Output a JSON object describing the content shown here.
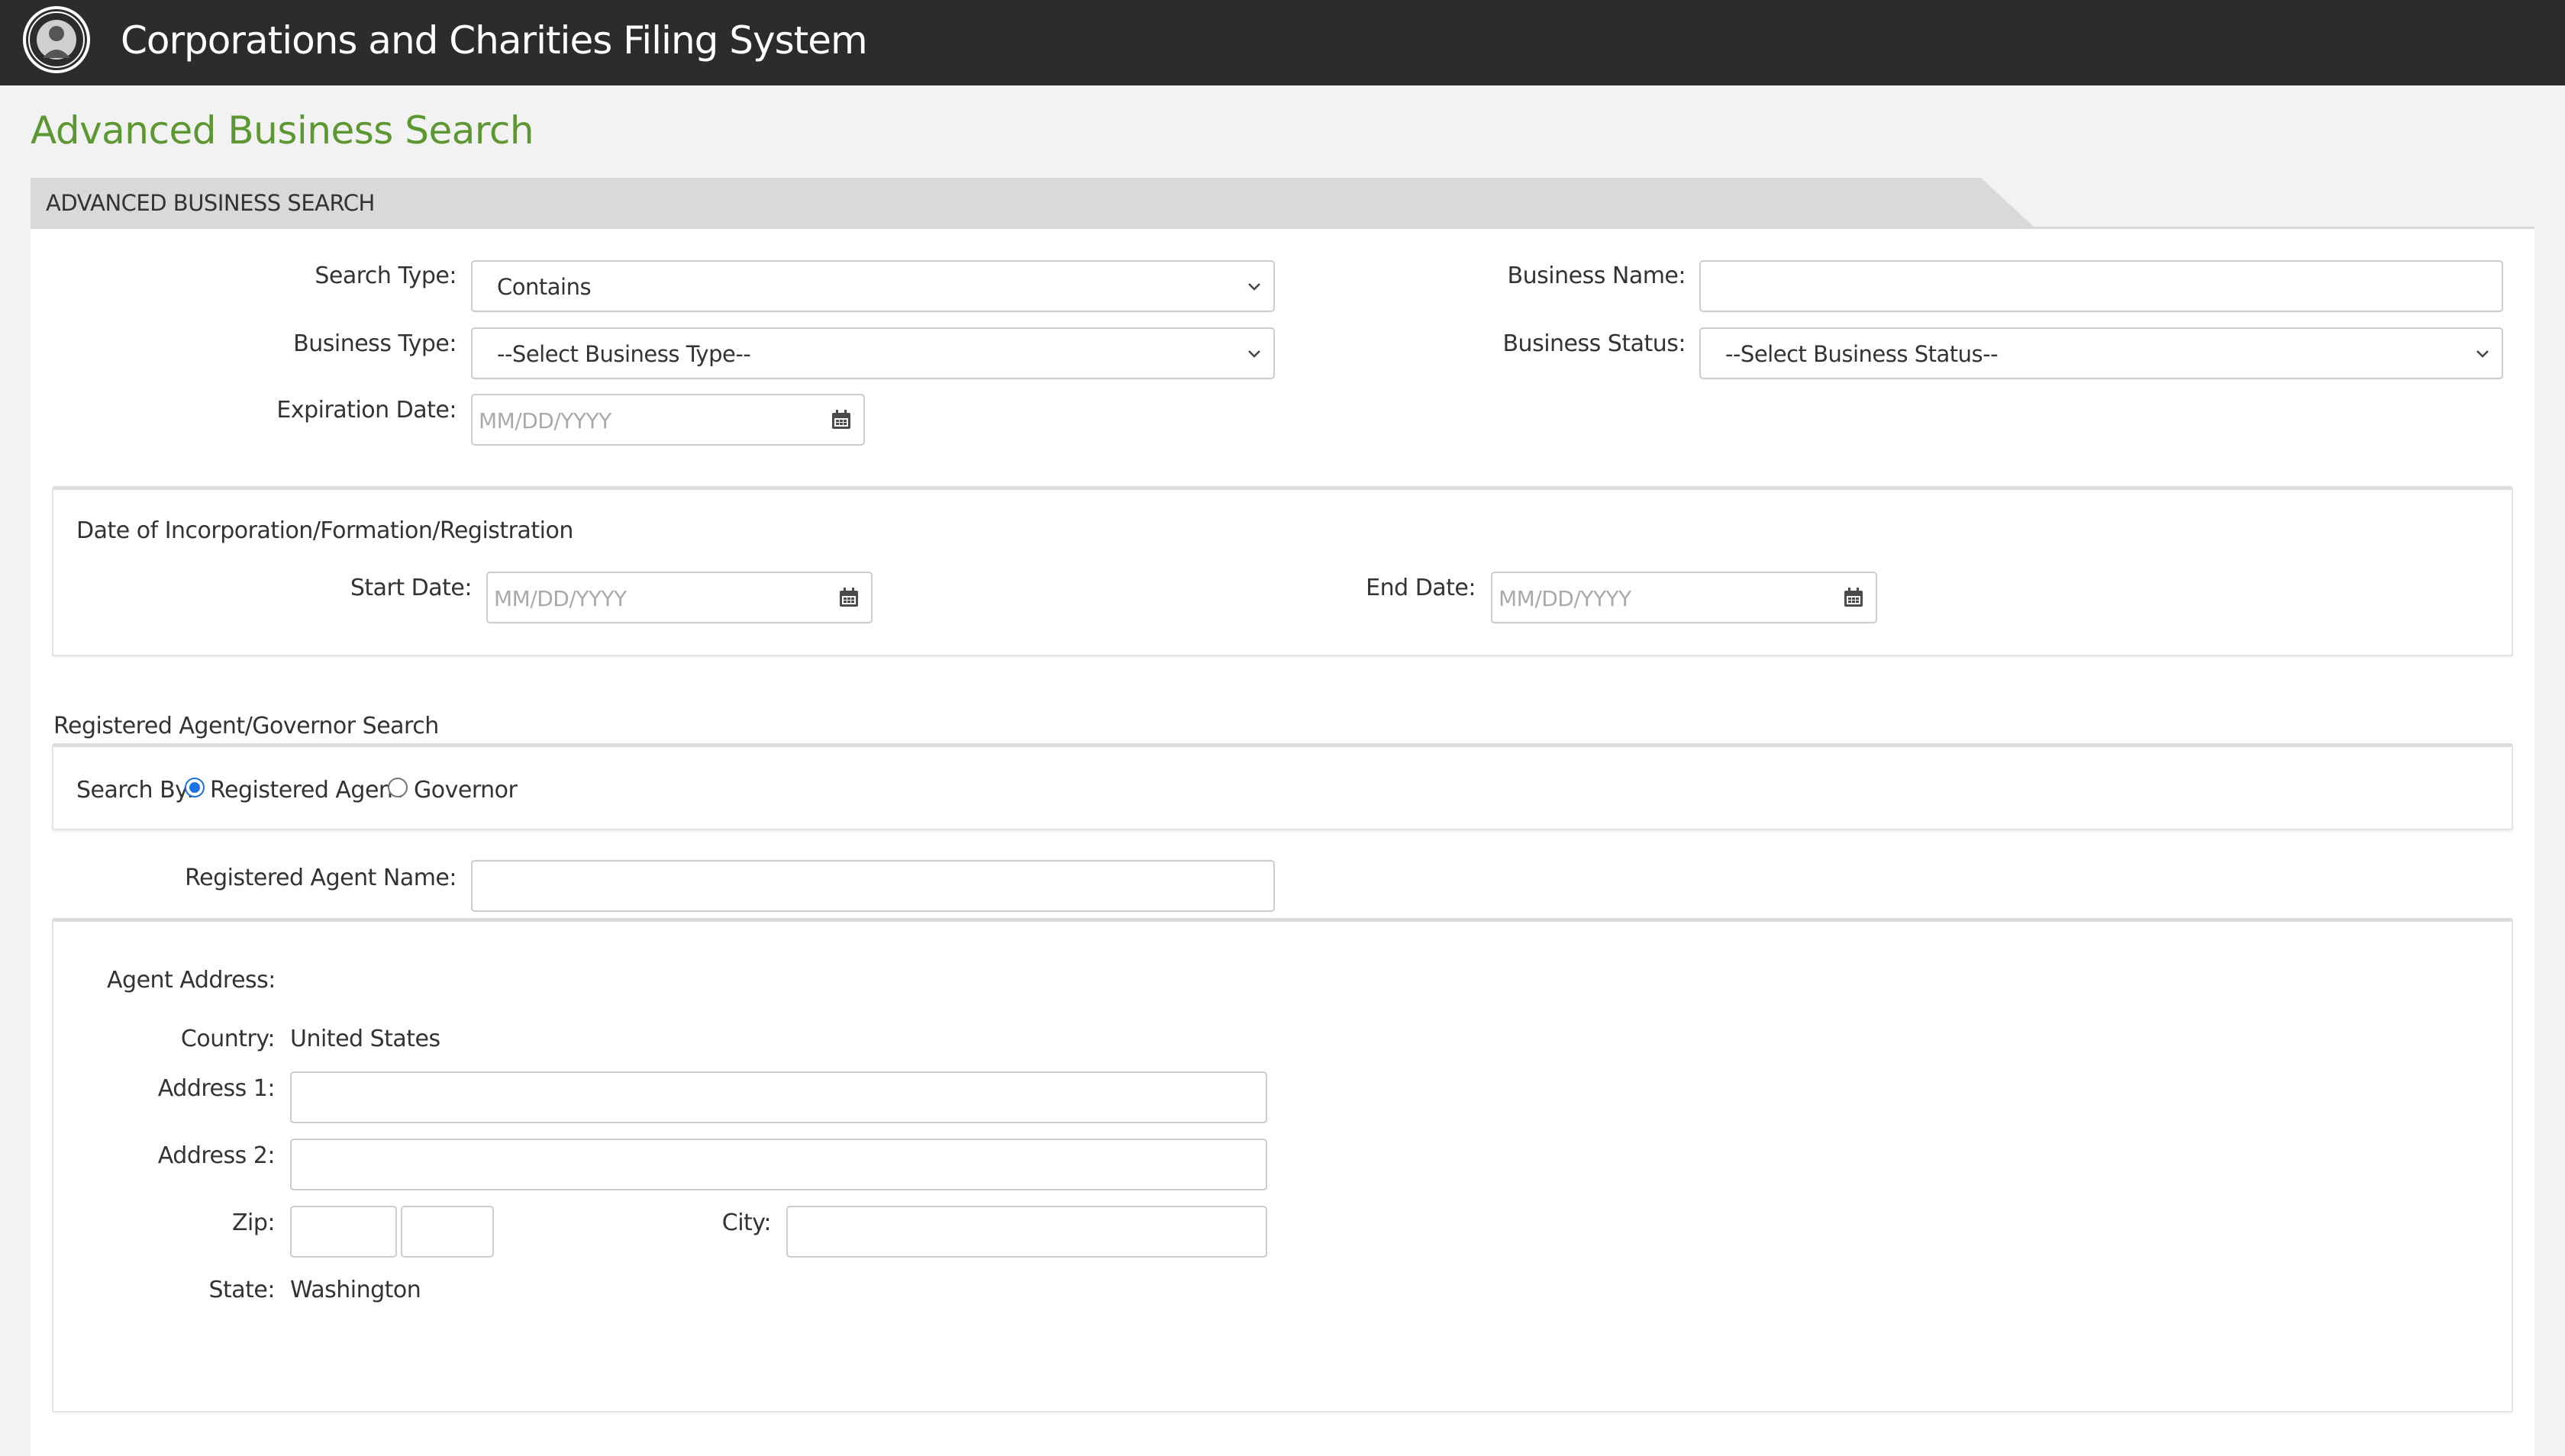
{
  "header": {
    "app_title": "Corporations and Charities Filing System",
    "logo_icon": "state-seal-icon"
  },
  "page": {
    "title": "Advanced Business Search"
  },
  "section_tab": {
    "label": "ADVANCED BUSINESS SEARCH"
  },
  "search_form": {
    "search_type": {
      "label": "Search Type:",
      "value": "Contains"
    },
    "business_name": {
      "label": "Business Name:",
      "value": ""
    },
    "business_type": {
      "label": "Business Type:",
      "value": "--Select Business Type--"
    },
    "business_status": {
      "label": "Business Status:",
      "value": "--Select Business Status--"
    },
    "expiration_date": {
      "label": "Expiration Date:",
      "placeholder": "MM/DD/YYYY"
    }
  },
  "incorporation": {
    "title": "Date of Incorporation/Formation/Registration",
    "start_date": {
      "label": "Start Date:",
      "placeholder": "MM/DD/YYYY"
    },
    "end_date": {
      "label": "End Date:",
      "placeholder": "MM/DD/YYYY"
    }
  },
  "agent_search": {
    "title": "Registered Agent/Governor Search",
    "search_by_label": "Search By:",
    "options": [
      {
        "label": "Registered Agent",
        "selected": true
      },
      {
        "label": "Governor",
        "selected": false
      }
    ],
    "agent_name_label": "Registered Agent Name:"
  },
  "agent_address": {
    "title": "Agent Address:",
    "country_label": "Country:",
    "country_value": "United States",
    "address1_label": "Address 1:",
    "address2_label": "Address 2:",
    "zip_label": "Zip:",
    "city_label": "City:",
    "state_label": "State:",
    "state_value": "Washington"
  },
  "colors": {
    "header_bg": "#2c2c2c",
    "title_green": "#5d9732",
    "radio_blue": "#1a73e8"
  }
}
